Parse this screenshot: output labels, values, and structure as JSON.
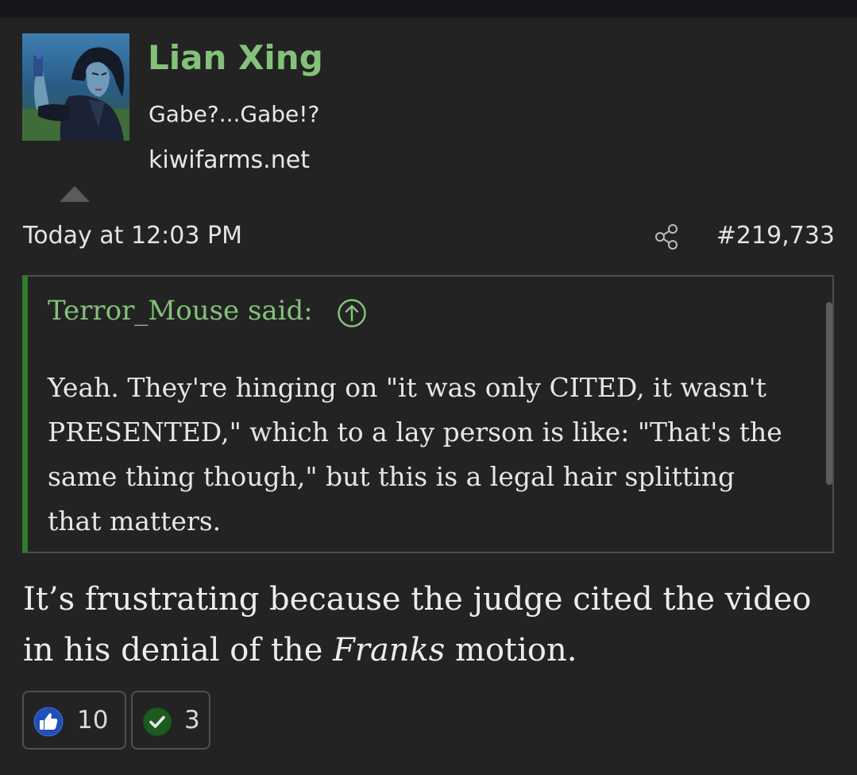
{
  "user": {
    "name": "Lian Xing",
    "title": "Gabe?...Gabe!?",
    "site": "kiwifarms.net"
  },
  "post": {
    "date": "Today at 12:03 PM",
    "number": "#219,733"
  },
  "quote": {
    "author": "Terror_Mouse said:",
    "lines": [
      "Yeah. They're hinging on \"it was only CITED, it wasn't",
      "PRESENTED,\" which to a lay person is like: \"That's the",
      "same thing though,\" but this is a legal hair splitting",
      "that matters."
    ]
  },
  "body": {
    "line1": "It’s frustrating because the judge cited the video",
    "line2_before": "in his denial of the ",
    "line2_italic": "Franks",
    "line2_after": " motion."
  },
  "reactions": [
    {
      "icon": "thumbs-up-icon",
      "count": "10",
      "color": "#1f4fb8"
    },
    {
      "icon": "checkmark-icon",
      "count": "3",
      "color": "#1f5a1f"
    }
  ],
  "colors": {
    "username": "#84c17a",
    "quote_border": "#2e7d2b",
    "background": "#232323"
  }
}
